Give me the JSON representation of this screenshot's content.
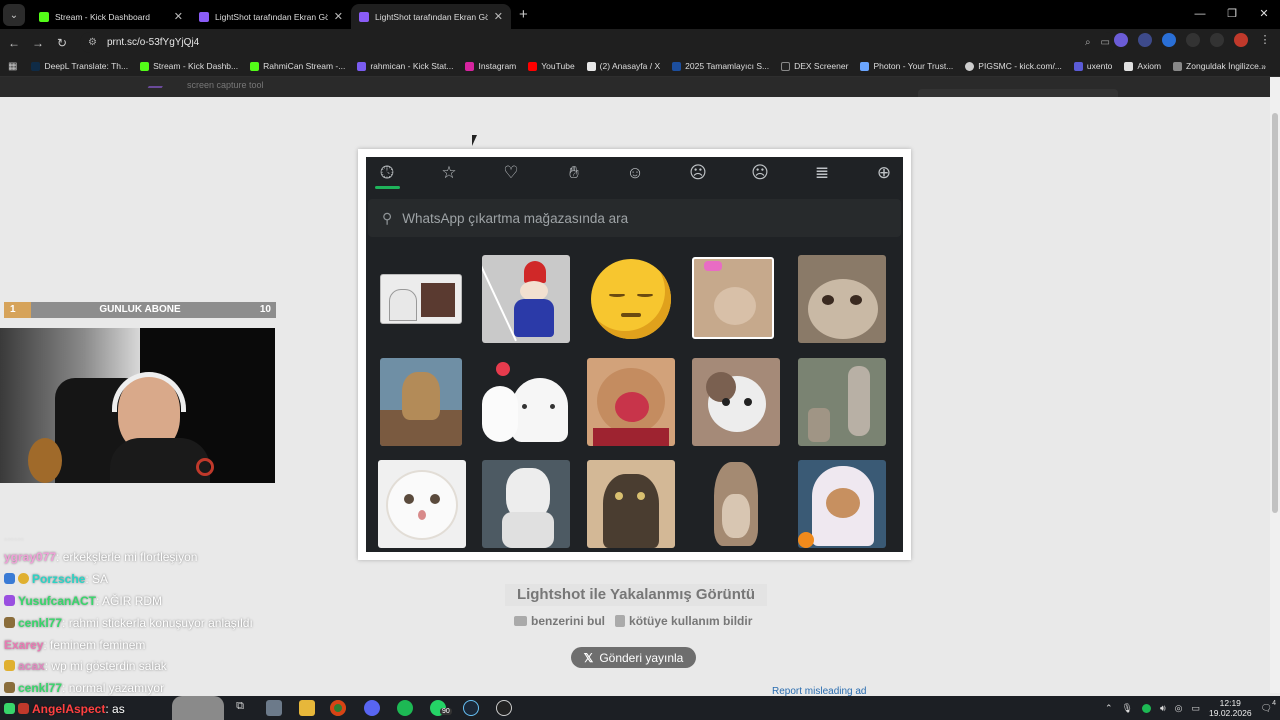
{
  "browser": {
    "tabs": [
      {
        "title": "Stream - Kick Dashboard",
        "color": "#53fc18",
        "active": false
      },
      {
        "title": "LightShot tarafından Ekran Gör...",
        "color": "#8a5cf6",
        "active": false
      },
      {
        "title": "LightShot tarafından Ekran Gör...",
        "color": "#8a5cf6",
        "active": true
      }
    ],
    "url": "prnt.sc/o-53fYgYjQj4",
    "url_prefix": "prnt.sc/",
    "bookmarks": [
      {
        "label": "DeepL Translate: Th...",
        "color": "#0f2b46"
      },
      {
        "label": "Stream - Kick Dashb...",
        "color": "#53fc18"
      },
      {
        "label": "RahmiCan Stream -...",
        "color": "#53fc18"
      },
      {
        "label": "rahmican - Kick Stat...",
        "color": "#7a5cf0"
      },
      {
        "label": "Instagram",
        "color": "#d6249f"
      },
      {
        "label": "YouTube",
        "color": "#ff0000"
      },
      {
        "label": "(2) Anasayfa / X",
        "color": "#e7e7e7"
      },
      {
        "label": "2025 Tamamlayıcı S...",
        "color": "#1c4e9d"
      },
      {
        "label": "DEX Screener",
        "color": "#222222"
      },
      {
        "label": "Photon - Your Trust...",
        "color": "#6aa5ff"
      },
      {
        "label": "PIGSMC - kick.com/...",
        "color": "#cccccc"
      },
      {
        "label": "uxento",
        "color": "#5b5bd6"
      },
      {
        "label": "Axiom",
        "color": "#e0e0e0"
      },
      {
        "label": "Zonguldak İngilizce...",
        "color": "#888888"
      }
    ]
  },
  "lightshot": {
    "header_sub": "screen capture tool",
    "caption": "Lightshot ile Yakalanmış Görüntü",
    "find_similar": "benzerini bul",
    "report_abuse": "kötüye kullanım bildir",
    "post_button": "Gönderi yayınla",
    "report_ad": "Report misleading ad"
  },
  "screenshot": {
    "search_placeholder": "WhatsApp çıkartma mağazasında ara",
    "tabs": [
      "clock-icon",
      "star-icon",
      "heart-icon",
      "wave-icon",
      "smile-icon",
      "emoji-icon",
      "sad-icon",
      "stack-icon",
      "add-icon"
    ],
    "accent": "#1fb35b",
    "stickers": [
      {
        "name": "person-at-desk",
        "c1": "#ececec",
        "c2": "#5a3a30"
      },
      {
        "name": "gnome",
        "c1": "#c9c9c9",
        "c2": "#2b3aa8"
      },
      {
        "name": "relieved-emoji",
        "c1": "#f7c62f",
        "c2": "#e0a11c"
      },
      {
        "name": "cat-with-bow",
        "c1": "#c6a98c",
        "c2": "#e86cc4"
      },
      {
        "name": "cat-closeup",
        "c1": "#8a7a68",
        "c2": "#c9b9a5"
      },
      {
        "name": "dog-on-table",
        "c1": "#6f8fa5",
        "c2": "#b38b58"
      },
      {
        "name": "cat-with-heart",
        "c1": "#f6f6f6",
        "c2": "#e63b4d"
      },
      {
        "name": "cat-licking",
        "c1": "#d2a27a",
        "c2": "#9e2330"
      },
      {
        "name": "kitten-held",
        "c1": "#a58a78",
        "c2": "#ededed"
      },
      {
        "name": "man-with-dog",
        "c1": "#7a8372",
        "c2": "#b8b0a5"
      },
      {
        "name": "white-cat",
        "c1": "#f0f0f0",
        "c2": "#d6d0c8"
      },
      {
        "name": "white-dog",
        "c1": "#4d5a63",
        "c2": "#ededed"
      },
      {
        "name": "tabby-cat",
        "c1": "#d3b896",
        "c2": "#4a3d30"
      },
      {
        "name": "standing-cat",
        "c1": "#e8e4de",
        "c2": "#a48a72"
      },
      {
        "name": "cat-in-ghost-costume",
        "c1": "#3a5a75",
        "c2": "#efe8f0"
      }
    ]
  },
  "overlay": {
    "goal": {
      "current": "1",
      "label": "GUNLUK ABONE",
      "target": "10",
      "fraction": 0.1
    },
    "chat": [
      {
        "user": "ygray077",
        "text": ": erkekşlerle mi flortleşiyon",
        "color": "#f0a0d8",
        "badge": ""
      },
      {
        "user": "Porzsche",
        "text": ": SA",
        "color": "#2bd3c5",
        "badge": "#3a7bd5"
      },
      {
        "user": "YusufcanACT",
        "text": ": AĞIR RDM",
        "color": "#38d66b",
        "badge": "#9a4fe0"
      },
      {
        "user": "cenkl77",
        "text": ": rahmi stickerla konuşuyor anlaşıldı",
        "color": "#38d66b",
        "badge": "#8a6d3b"
      },
      {
        "user": "Exarey",
        "text": ": feminem feminem",
        "color": "#e87ab3",
        "badge": ""
      },
      {
        "user": "acax",
        "text": ": wp mi gösterdin salak",
        "color": "#e08ac0",
        "badge": "#e0b030"
      },
      {
        "user": "cenkl77",
        "text": ": normal yazamıyor",
        "color": "#38d66b",
        "badge": "#8a6d3b"
      },
      {
        "user": "AngelAspect",
        "text": ": as",
        "color": "#ff4040",
        "badge": "#38d66b"
      }
    ]
  },
  "taskbar": {
    "time": "12:19",
    "date": "19.02.2026",
    "whatsapp_badge": "90",
    "notification_count": "4"
  }
}
